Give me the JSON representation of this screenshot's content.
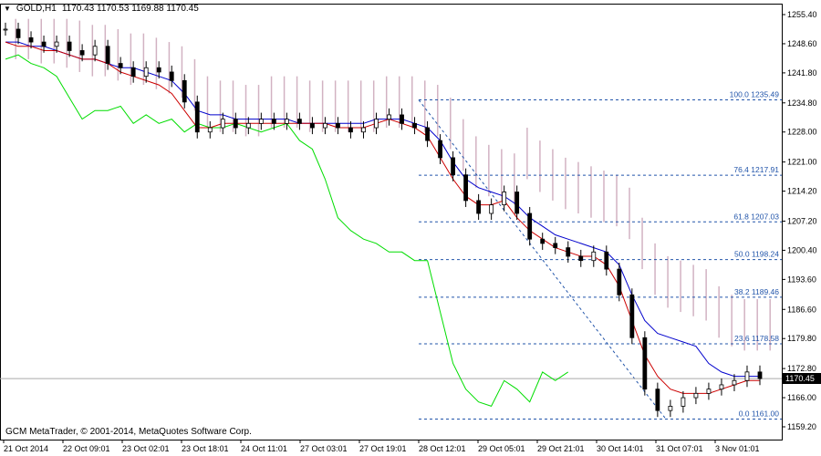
{
  "header": {
    "menu_arrow": "▼",
    "symbol": "GOLD,H1",
    "ohlc": "1170.43 1170.53 1169.88 1170.45"
  },
  "footer": {
    "copyright": "GCM MetaTrader, © 2001-2014, MetaQuotes Software Corp."
  },
  "current_price": "1170.45",
  "colors": {
    "background": "#ffffff",
    "grid": "#000000",
    "tenkan": "#cc0000",
    "kijun": "#0000cc",
    "chikou": "#00dd00",
    "kumo_up": "#c8a0b4",
    "kumo_down": "#f0a070",
    "fibo": "#2255aa",
    "candles": "#000000"
  },
  "chart_data": {
    "type": "line",
    "subtype": "candlestick-with-ichimoku-and-fibonacci",
    "symbol": "GOLD",
    "timeframe": "H1",
    "y_axis_labels": [
      "1255.40",
      "1248.60",
      "1241.80",
      "1234.80",
      "1228.00",
      "1221.00",
      "1214.20",
      "1207.20",
      "1200.40",
      "1193.60",
      "1186.60",
      "1179.80",
      "1172.80",
      "1166.00",
      "1159.20"
    ],
    "x_axis_labels": [
      "21 Oct 2014",
      "22 Oct 09:01",
      "23 Oct 02:01",
      "23 Oct 18:01",
      "24 Oct 11:01",
      "27 Oct 03:01",
      "27 Oct 19:01",
      "28 Oct 12:01",
      "29 Oct 05:01",
      "29 Oct 21:01",
      "30 Oct 14:01",
      "31 Oct 07:01",
      "3 Nov 01:01"
    ],
    "ylim": [
      1159.2,
      1255.4
    ],
    "fibonacci": [
      {
        "level": "100.0",
        "price": "1235.49",
        "value": 1235.49
      },
      {
        "level": "76.4",
        "price": "1217.91",
        "value": 1217.91
      },
      {
        "level": "61.8",
        "price": "1207.03",
        "value": 1207.03
      },
      {
        "level": "50.0",
        "price": "1198.24",
        "value": 1198.24
      },
      {
        "level": "38.2",
        "price": "1189.46",
        "value": 1189.46
      },
      {
        "level": "23.6",
        "price": "1178.58",
        "value": 1178.58
      },
      {
        "level": "0.0",
        "price": "1161.00",
        "value": 1161.0
      }
    ],
    "series": [
      {
        "name": "Close",
        "values": [
          1252,
          1250,
          1249,
          1248,
          1249,
          1247,
          1246,
          1248,
          1244,
          1243,
          1241,
          1243,
          1242,
          1240,
          1235,
          1228,
          1229,
          1231,
          1229,
          1230,
          1231,
          1230,
          1231,
          1230,
          1229,
          1230,
          1229,
          1228,
          1229,
          1231,
          1232,
          1230,
          1229,
          1226,
          1222,
          1218,
          1212,
          1209,
          1211,
          1214,
          1209,
          1203,
          1202,
          1201,
          1199,
          1198,
          1200,
          1196,
          1190,
          1180,
          1168,
          1163,
          1164,
          1166,
          1167,
          1168,
          1169,
          1170,
          1172,
          1170.45
        ]
      },
      {
        "name": "Tenkan",
        "values": [
          1249,
          1248,
          1248,
          1247,
          1247,
          1246,
          1245,
          1245,
          1244,
          1242,
          1241,
          1240,
          1239,
          1237,
          1233,
          1229,
          1229,
          1230,
          1230,
          1230,
          1230,
          1230,
          1230,
          1230,
          1230,
          1230,
          1229,
          1229,
          1229,
          1230,
          1231,
          1230,
          1229,
          1227,
          1222,
          1217,
          1213,
          1211,
          1211,
          1212,
          1208,
          1205,
          1203,
          1201,
          1200,
          1199,
          1199,
          1197,
          1192,
          1184,
          1176,
          1171,
          1168,
          1167,
          1167,
          1167,
          1168,
          1169,
          1170,
          1170
        ]
      },
      {
        "name": "Kijun",
        "values": [
          1249,
          1249,
          1248,
          1248,
          1247,
          1246,
          1245,
          1245,
          1244,
          1243,
          1243,
          1242,
          1241,
          1240,
          1237,
          1233,
          1232,
          1232,
          1231,
          1231,
          1231,
          1231,
          1231,
          1230,
          1230,
          1230,
          1230,
          1230,
          1230,
          1231,
          1231,
          1231,
          1230,
          1229,
          1226,
          1221,
          1217,
          1215,
          1214,
          1213,
          1211,
          1208,
          1206,
          1204,
          1203,
          1202,
          1201,
          1200,
          1197,
          1190,
          1184,
          1181,
          1180,
          1179,
          1178,
          1174,
          1172,
          1171,
          1171,
          1171
        ]
      },
      {
        "name": "Chikou",
        "values": [
          1245,
          1246,
          1244,
          1243,
          1241,
          1236,
          1231,
          1233,
          1233,
          1234,
          1230,
          1232,
          1230,
          1231,
          1228,
          1230,
          1229,
          1229,
          1230,
          1229,
          1228,
          1229,
          1230,
          1226,
          1224,
          1217,
          1208,
          1205,
          1203,
          1202,
          1200,
          1200,
          1198,
          1198,
          1186,
          1174,
          1168,
          1165,
          1164,
          1170,
          1168,
          1165,
          1172,
          1170,
          1172,
          null,
          null,
          null,
          null,
          null,
          null,
          null,
          null,
          null,
          null,
          null,
          null,
          null,
          null,
          null
        ]
      }
    ]
  }
}
